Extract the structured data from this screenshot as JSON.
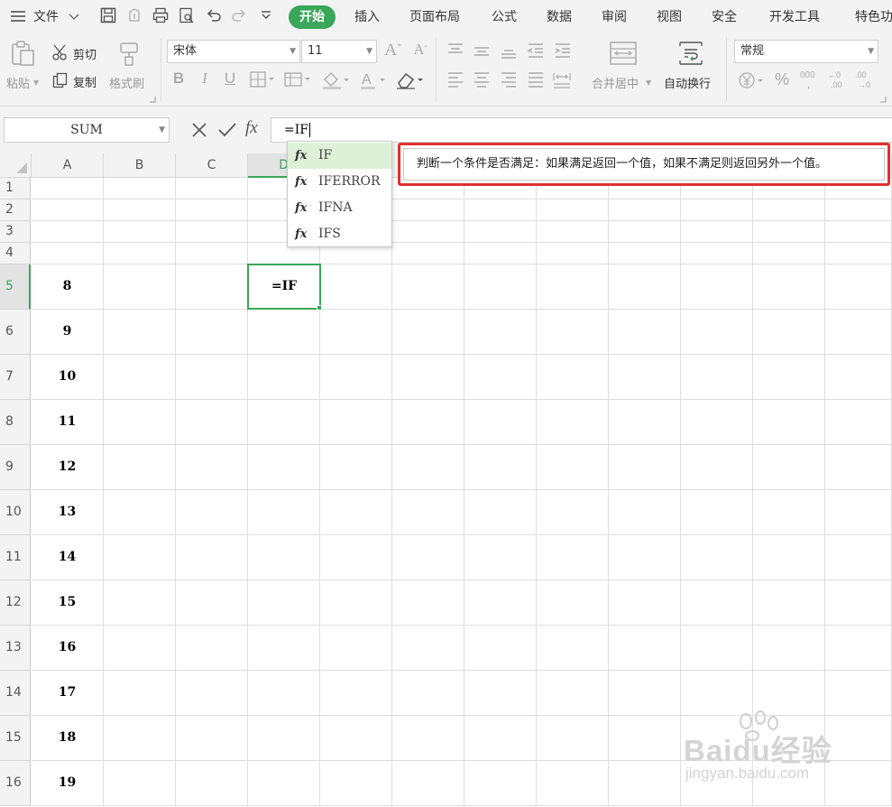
{
  "menu": {
    "file_label": "文件",
    "tabs": [
      "开始",
      "插入",
      "页面布局",
      "公式",
      "数据",
      "审阅",
      "视图",
      "安全",
      "开发工具",
      "特色功"
    ]
  },
  "ribbon": {
    "paste_label": "粘贴",
    "cut_label": "剪切",
    "copy_label": "复制",
    "format_painter_label": "格式刷",
    "font_name": "宋体",
    "font_size": "11",
    "merge_center_label": "合并居中",
    "wrap_text_label": "自动换行",
    "number_format": "常规"
  },
  "formula_bar": {
    "name_box": "SUM",
    "formula": "=IF"
  },
  "columns": [
    "A",
    "B",
    "C",
    "D"
  ],
  "rows": [
    {
      "num": "1",
      "a": ""
    },
    {
      "num": "2",
      "a": ""
    },
    {
      "num": "3",
      "a": ""
    },
    {
      "num": "4",
      "a": ""
    },
    {
      "num": "5",
      "a": "8"
    },
    {
      "num": "6",
      "a": "9"
    },
    {
      "num": "7",
      "a": "10"
    },
    {
      "num": "8",
      "a": "11"
    },
    {
      "num": "9",
      "a": "12"
    },
    {
      "num": "10",
      "a": "13"
    },
    {
      "num": "11",
      "a": "14"
    },
    {
      "num": "12",
      "a": "15"
    },
    {
      "num": "13",
      "a": "16"
    },
    {
      "num": "14",
      "a": "17"
    },
    {
      "num": "15",
      "a": "18"
    },
    {
      "num": "16",
      "a": "19"
    }
  ],
  "active_cell_value": "=IF",
  "autocomplete": {
    "fx_symbol": "fx",
    "items": [
      "IF",
      "IFERROR",
      "IFNA",
      "IFS"
    ]
  },
  "tooltip": "判断一个条件是否满足：如果满足返回一个值，如果不满足则返回另外一个值。",
  "watermark": {
    "logo": "Baidu经验",
    "url": "jingyan.baidu.com"
  },
  "colors": {
    "accent": "#39a65a",
    "highlight_border": "#e03030"
  }
}
